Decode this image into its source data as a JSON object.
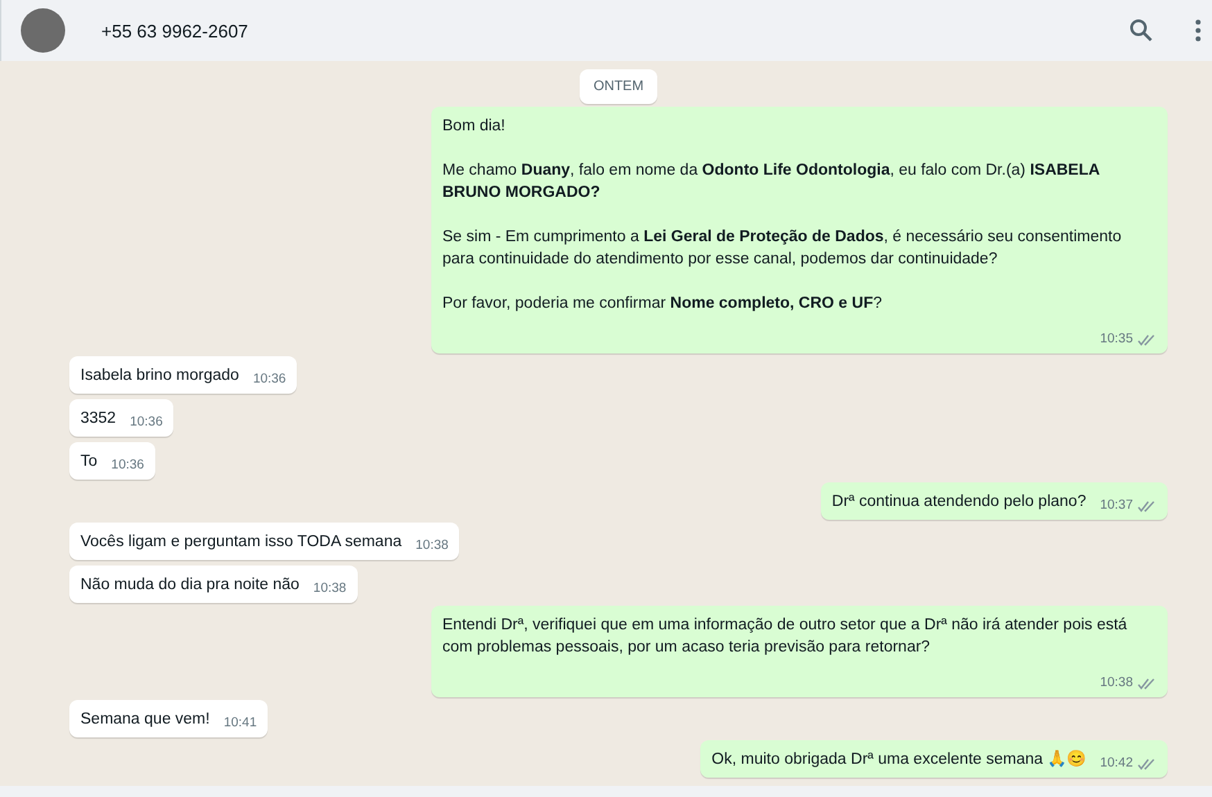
{
  "header": {
    "contact": "+55 63 9962-2607"
  },
  "date_chip": "ONTEM",
  "groups": [
    {
      "kind": "out",
      "messages": [
        {
          "paragraphs": [
            "Bom dia!",
            "Me chamo **Duany**, falo em nome da **Odonto Life Odontologia**, eu falo com Dr.(a) **ISABELA BRUNO MORGADO?**",
            "Se sim - Em cumprimento a **Lei Geral de Proteção de Dados**, é necessário seu consentimento para continuidade do atendimento por esse canal, podemos dar continuidade?",
            "Por favor, poderia me confirmar **Nome completo, CRO e UF**?"
          ],
          "time": "10:35"
        }
      ]
    },
    {
      "kind": "in",
      "messages": [
        {
          "paragraphs": [
            "Isabela brino morgado"
          ],
          "time": "10:36"
        },
        {
          "paragraphs": [
            "3352"
          ],
          "time": "10:36"
        },
        {
          "paragraphs": [
            "To"
          ],
          "time": "10:36"
        }
      ]
    },
    {
      "kind": "out",
      "messages": [
        {
          "paragraphs": [
            "Drª continua atendendo pelo plano?"
          ],
          "time": "10:37"
        }
      ]
    },
    {
      "kind": "in",
      "messages": [
        {
          "paragraphs": [
            "Vocês ligam e perguntam isso TODA semana"
          ],
          "time": "10:38"
        },
        {
          "paragraphs": [
            "Não muda do dia pra noite não"
          ],
          "time": "10:38"
        }
      ]
    },
    {
      "kind": "out",
      "messages": [
        {
          "paragraphs": [
            "Entendi Drª, verifiquei que em uma informação de outro setor que a Drª não irá atender pois está com problemas pessoais, por um acaso teria previsão para retornar?"
          ],
          "time": "10:38"
        }
      ]
    },
    {
      "kind": "in",
      "messages": [
        {
          "paragraphs": [
            "Semana que vem!"
          ],
          "time": "10:41"
        }
      ]
    },
    {
      "kind": "out",
      "messages": [
        {
          "paragraphs": [
            "Ok, muito obrigada Drª uma excelente semana 🙏😊"
          ],
          "time": "10:42"
        }
      ]
    }
  ]
}
